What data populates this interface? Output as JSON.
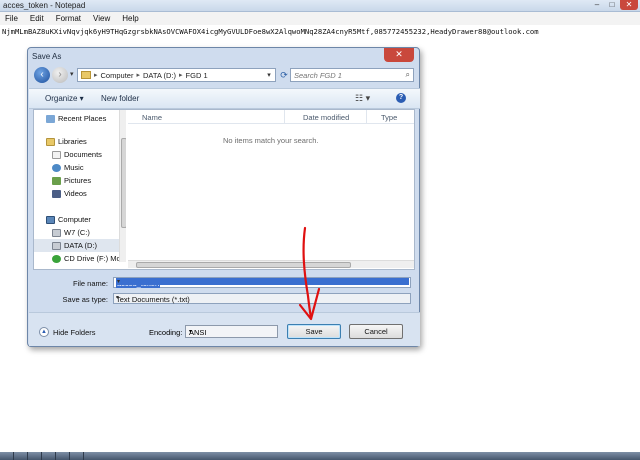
{
  "notepad": {
    "title": "acces_token - Notepad",
    "menu": [
      "File",
      "Edit",
      "Format",
      "View",
      "Help"
    ],
    "content": "NjmMLmBAZ8uKXivNqvjqk6yH9THqGzgrsbkNAsOVCWAFOX4icgMyGVULDFoe8wX2AlqwoMNq28ZA4cnyR5Mtf,085772455232,HeadyDrawer88@outlook.com"
  },
  "dialog": {
    "title": "Save As",
    "breadcrumb": [
      "Computer",
      "DATA (D:)",
      "FGD 1"
    ],
    "search_placeholder": "Search FGD 1",
    "toolbar": {
      "organize": "Organize ▾",
      "new_folder": "New folder"
    },
    "nav_items": [
      {
        "label": "Recent Places",
        "icon": "recent-places-icon"
      },
      {
        "label": "Libraries",
        "icon": "libraries-icon"
      },
      {
        "label": "Documents",
        "icon": "documents-icon"
      },
      {
        "label": "Music",
        "icon": "music-icon"
      },
      {
        "label": "Pictures",
        "icon": "pictures-icon"
      },
      {
        "label": "Videos",
        "icon": "videos-icon"
      },
      {
        "label": "Computer",
        "icon": "computer-icon"
      },
      {
        "label": "W7 (C:)",
        "icon": "drive-icon"
      },
      {
        "label": "DATA (D:)",
        "icon": "drive-icon"
      },
      {
        "label": "CD Drive (F:) Mol",
        "icon": "cd-drive-icon"
      }
    ],
    "columns": [
      "Name",
      "Date modified",
      "Type"
    ],
    "empty_message": "No items match your search.",
    "file_name_label": "File name:",
    "file_name_value": "acces_token",
    "save_type_label": "Save as type:",
    "save_type_value": "Text Documents (*.txt)",
    "hide_folders": "Hide Folders",
    "encoding_label": "Encoding:",
    "encoding_value": "ANSI",
    "save_button": "Save",
    "cancel_button": "Cancel"
  },
  "colors": {
    "annotation": "#e01010",
    "accent": "#3a6fd0"
  }
}
